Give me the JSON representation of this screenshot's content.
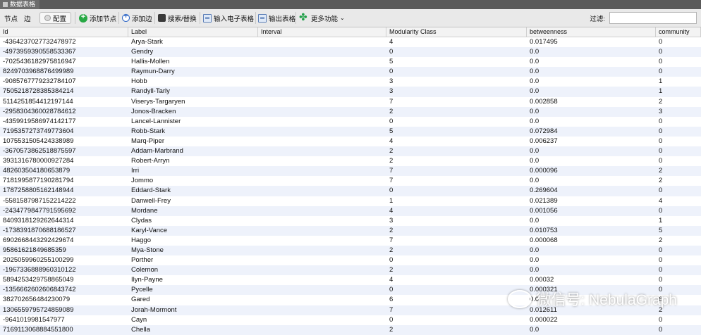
{
  "window": {
    "tab_title": "数据表格"
  },
  "toolbar": {
    "nodes_tab": "节点",
    "edges_tab": "边",
    "config_label": "配置",
    "add_node_label": "添加节点",
    "add_edge_label": "添加边",
    "search_replace_label": "搜索/替换",
    "import_spreadsheet_label": "输入电子表格",
    "export_table_label": "输出表格",
    "more_actions_label": "更多功能",
    "filter_label": "过滤:",
    "filter_value": ""
  },
  "table": {
    "columns": [
      "Id",
      "Label",
      "Interval",
      "Modularity Class",
      "betweenness",
      "community"
    ],
    "rows": [
      [
        "-4364237027732478972",
        "Arya-Stark",
        "",
        "4",
        "0.017495",
        "0"
      ],
      [
        "-4973959390558533367",
        "Gendry",
        "",
        "0",
        "0.0",
        "0"
      ],
      [
        "-7025436182975816947",
        "Hallis-Mollen",
        "",
        "5",
        "0.0",
        "0"
      ],
      [
        "8249703968876499989",
        "Raymun-Darry",
        "",
        "0",
        "0.0",
        "0"
      ],
      [
        "-9085767779232784107",
        "Hobb",
        "",
        "3",
        "0.0",
        "1"
      ],
      [
        "7505218728385384214",
        "Randyll-Tarly",
        "",
        "3",
        "0.0",
        "1"
      ],
      [
        "5114251854412197144",
        "Viserys-Targaryen",
        "",
        "7",
        "0.002858",
        "2"
      ],
      [
        "-2958304360028784612",
        "Jonos-Bracken",
        "",
        "2",
        "0.0",
        "3"
      ],
      [
        "-4359919586974142177",
        "Lancel-Lannister",
        "",
        "0",
        "0.0",
        "0"
      ],
      [
        "7195357273749773604",
        "Robb-Stark",
        "",
        "5",
        "0.072984",
        "0"
      ],
      [
        "1075531505424338989",
        "Marq-Piper",
        "",
        "4",
        "0.006237",
        "0"
      ],
      [
        "-3670573862518875597",
        "Addam-Marbrand",
        "",
        "2",
        "0.0",
        "0"
      ],
      [
        "3931316780000927284",
        "Robert-Arryn",
        "",
        "2",
        "0.0",
        "0"
      ],
      [
        "482603504180653879",
        "Irri",
        "",
        "7",
        "0.000096",
        "2"
      ],
      [
        "7181995877190281794",
        "Jommo",
        "",
        "7",
        "0.0",
        "2"
      ],
      [
        "1787258805162148944",
        "Eddard-Stark",
        "",
        "0",
        "0.269604",
        "0"
      ],
      [
        "-5581587987152214222",
        "Danwell-Frey",
        "",
        "1",
        "0.021389",
        "4"
      ],
      [
        "-2434779847791595692",
        "Mordane",
        "",
        "4",
        "0.001056",
        "0"
      ],
      [
        "8409318129262644314",
        "Clydas",
        "",
        "3",
        "0.0",
        "1"
      ],
      [
        "-1738391870688186527",
        "Karyl-Vance",
        "",
        "2",
        "0.010753",
        "5"
      ],
      [
        "6902668443292429674",
        "Haggo",
        "",
        "7",
        "0.000068",
        "2"
      ],
      [
        "95861621849685359",
        "Mya-Stone",
        "",
        "2",
        "0.0",
        "0"
      ],
      [
        "2025059960255100299",
        "Porther",
        "",
        "0",
        "0.0",
        "0"
      ],
      [
        "-1967336888960310122",
        "Colemon",
        "",
        "2",
        "0.0",
        "0"
      ],
      [
        "5894253429758865049",
        "Ilyn-Payne",
        "",
        "4",
        "0.00032",
        "0"
      ],
      [
        "-1356662602606843742",
        "Pycelle",
        "",
        "0",
        "0.000321",
        "0"
      ],
      [
        "382702656484230079",
        "Gared",
        "",
        "6",
        "0.0",
        "6"
      ],
      [
        "1306559795724859089",
        "Jorah-Mormont",
        "",
        "7",
        "0.012611",
        "2"
      ],
      [
        "-9641019981547977",
        "Cayn",
        "",
        "0",
        "0.000022",
        "0"
      ],
      [
        "7169113068884551800",
        "Chella",
        "",
        "2",
        "0.0",
        "0"
      ]
    ]
  },
  "watermark": {
    "text": "微信号: NebulaGraph"
  }
}
